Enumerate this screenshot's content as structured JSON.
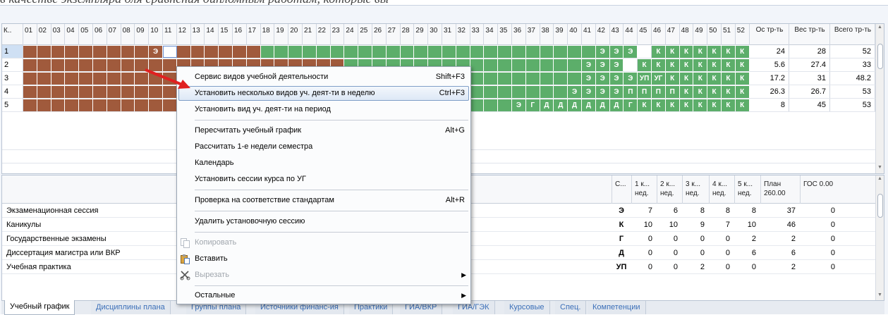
{
  "caption": "в качестве экземпляра для сравнения дипломным работам, которые вы",
  "upper": {
    "row_header": "К..",
    "weeks": [
      "01",
      "02",
      "03",
      "04",
      "05",
      "06",
      "07",
      "08",
      "09",
      "10",
      "11",
      "12",
      "13",
      "14",
      "15",
      "16",
      "17",
      "18",
      "19",
      "20",
      "21",
      "22",
      "23",
      "24",
      "25",
      "26",
      "27",
      "28",
      "29",
      "30",
      "31",
      "32",
      "33",
      "34",
      "35",
      "36",
      "37",
      "38",
      "39",
      "40",
      "41",
      "42",
      "43",
      "44",
      "45",
      "46",
      "47",
      "48",
      "49",
      "50",
      "51",
      "52"
    ],
    "sum_headers": [
      "Ос тр-ть",
      "Вес тр-ть",
      "Всего тр-ть"
    ],
    "rows": [
      {
        "course": "1",
        "cells": [
          "Э",
          "",
          "",
          "",
          "",
          "",
          "",
          "",
          "",
          "",
          "",
          "",
          "",
          "",
          "",
          "",
          "",
          "",
          "",
          "",
          "",
          "",
          "",
          "",
          "",
          "",
          "",
          "Э",
          "Э",
          "Э",
          "",
          "К",
          "К",
          "К",
          "К",
          "К",
          "К",
          "К",
          "К"
        ],
        "os": "24",
        "ves": "28",
        "total": "52"
      },
      {
        "course": "2",
        "cells": [
          "Э",
          "Э",
          "Э",
          "",
          "К",
          "К",
          "К",
          "К",
          "К",
          "К",
          "К",
          "К"
        ],
        "os": "5.6",
        "ves": "27.4",
        "total": "33"
      },
      {
        "course": "3",
        "cells": [
          "Э",
          "Э",
          "Э",
          "Э",
          "УП",
          "УГ",
          "К",
          "К",
          "К",
          "К",
          "К",
          "К"
        ],
        "os": "17.2",
        "ves": "31",
        "total": "48.2"
      },
      {
        "course": "4",
        "cells": [
          "Э",
          "Э",
          "Э",
          "Э",
          "П",
          "П",
          "П",
          "П",
          "К",
          "К",
          "К",
          "К",
          "К"
        ],
        "os": "26.3",
        "ves": "26.7",
        "total": "53"
      },
      {
        "course": "5",
        "cells": [
          "Э",
          "Г",
          "Д",
          "Д",
          "Д",
          "Д",
          "Д",
          "Д",
          "Г",
          "К",
          "К",
          "К",
          "К",
          "К",
          "К",
          "К",
          "К"
        ],
        "os": "8",
        "ves": "45",
        "total": "53"
      }
    ]
  },
  "lower": {
    "headers": [
      "С...",
      "1 к... нед.",
      "2 к... нед.",
      "3 к... нед.",
      "4 к... нед.",
      "5 к... нед.",
      "План 260.00",
      "ГОС 0.00"
    ],
    "rows": [
      {
        "name": "Экзаменационная сессия",
        "code": "Э",
        "v": [
          "7",
          "6",
          "8",
          "8",
          "8",
          "37",
          "0"
        ]
      },
      {
        "name": "Каникулы",
        "code": "К",
        "v": [
          "10",
          "10",
          "9",
          "7",
          "10",
          "46",
          "0"
        ]
      },
      {
        "name": "Государственные экзамены",
        "code": "Г",
        "v": [
          "0",
          "0",
          "0",
          "0",
          "2",
          "2",
          "0"
        ]
      },
      {
        "name": "Диссертация магистра или ВКР",
        "code": "Д",
        "v": [
          "0",
          "0",
          "0",
          "0",
          "6",
          "6",
          "0"
        ]
      },
      {
        "name": "Учебная практика",
        "code": "УП",
        "v": [
          "0",
          "0",
          "2",
          "0",
          "0",
          "2",
          "0"
        ]
      }
    ]
  },
  "menu": {
    "items": [
      {
        "label": "Сервис видов учебной деятельности",
        "shortcut": "Shift+F3"
      },
      {
        "label": "Установить несколько видов уч. деят-ти в неделю",
        "shortcut": "Ctrl+F3"
      },
      {
        "label": "Установить вид уч. деят-ти на период",
        "shortcut": ""
      },
      {
        "label": "Пересчитать учебный график",
        "shortcut": "Alt+G"
      },
      {
        "label": "Рассчитать 1-е недели семестра",
        "shortcut": ""
      },
      {
        "label": "Календарь",
        "shortcut": ""
      },
      {
        "label": "Установить сессии курса по УГ",
        "shortcut": ""
      },
      {
        "label": "Проверка на соответствие стандартам",
        "shortcut": "Alt+R"
      },
      {
        "label": "Удалить установочную сессию",
        "shortcut": ""
      },
      {
        "label": "Копировать",
        "shortcut": ""
      },
      {
        "label": "Вставить",
        "shortcut": ""
      },
      {
        "label": "Вырезать",
        "shortcut": ""
      },
      {
        "label": "Остальные",
        "shortcut": ""
      }
    ]
  },
  "tabs": [
    "Учебный график",
    "Дисциплины плана",
    "Группы плана",
    "Источники финанс-ия",
    "Практики",
    "ГИА/ВКР",
    "ГИА/ГЭК",
    "Курсовые",
    "Спец.",
    "Компетенции"
  ],
  "colors": {
    "brown": "#a05a3c",
    "green": "#5cae6a",
    "highlight_border": "#7d9dc6",
    "tab_link": "#3b6fb8",
    "arrow": "#e02020"
  },
  "icons": {
    "copy": "copy-icon",
    "paste": "paste-icon",
    "cut": "scissors-icon",
    "submenu": "chevron-right-icon",
    "scroll_up": "arrow-up-icon",
    "scroll_down": "arrow-down-icon"
  }
}
